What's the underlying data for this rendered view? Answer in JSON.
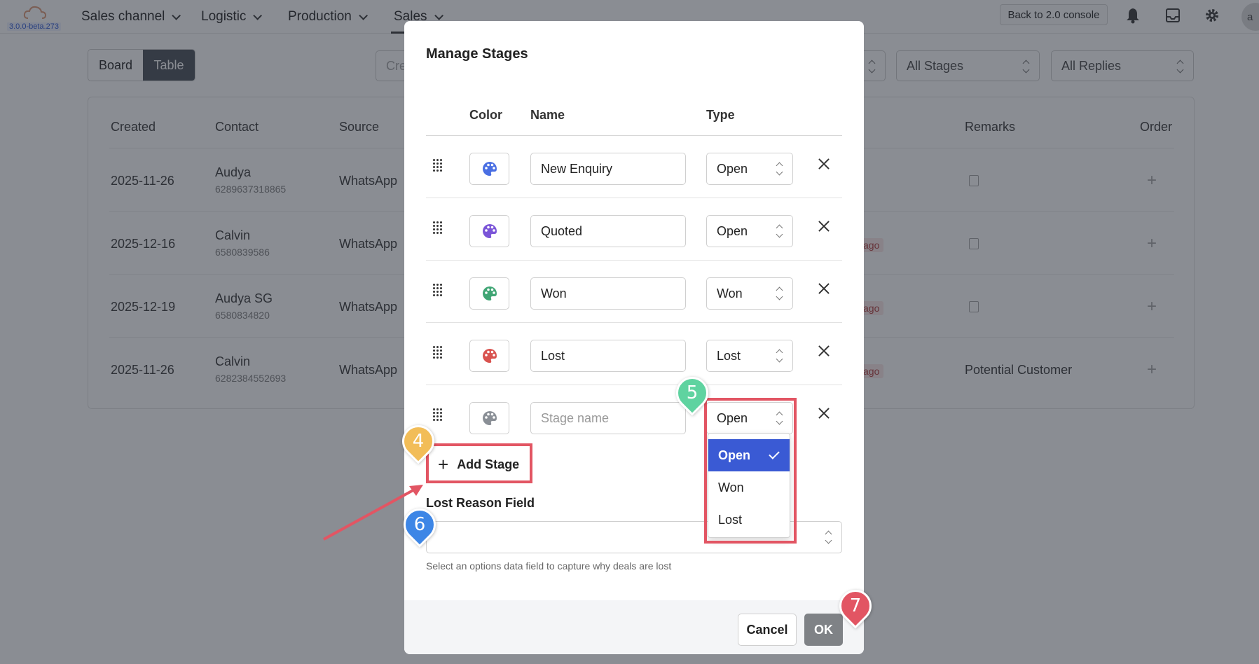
{
  "app": {
    "version": "3.0.0-beta.273",
    "nav": [
      {
        "label": "Sales channel"
      },
      {
        "label": "Logistic"
      },
      {
        "label": "Production"
      },
      {
        "label": "Sales"
      }
    ],
    "back_button": "Back to 2.0 console",
    "avatar_initials": "a"
  },
  "toolbar": {
    "view_board": "Board",
    "view_table": "Table",
    "search_placeholder": "Cre",
    "stages_filter": "All Stages",
    "replies_filter": "All Replies"
  },
  "table": {
    "headers": {
      "created": "Created",
      "contact": "Contact",
      "source": "Source",
      "remarks": "Remarks",
      "order": "Order"
    },
    "rows": [
      {
        "created": "2025-11-26",
        "name": "Audya",
        "phone": "6289637318865",
        "source": "WhatsApp",
        "badge": "",
        "remarks": ""
      },
      {
        "created": "2025-12-16",
        "name": "Calvin",
        "phone": "6580839586",
        "source": "WhatsApp",
        "badge": "ago",
        "remarks": ""
      },
      {
        "created": "2025-12-19",
        "name": "Audya SG",
        "phone": "6580834820",
        "source": "WhatsApp",
        "badge": "ago",
        "remarks": ""
      },
      {
        "created": "2025-11-26",
        "name": "Calvin",
        "phone": "6282384552693",
        "source": "WhatsApp",
        "badge": "ago",
        "remarks": "Potential Customer"
      }
    ]
  },
  "modal": {
    "title": "Manage Stages",
    "columns": {
      "color": "Color",
      "name": "Name",
      "type": "Type"
    },
    "stages": [
      {
        "name": "New Enquiry",
        "type": "Open",
        "color": "#4a6fe3"
      },
      {
        "name": "Quoted",
        "type": "Open",
        "color": "#7b55d8"
      },
      {
        "name": "Won",
        "type": "Won",
        "color": "#3fa574"
      },
      {
        "name": "Lost",
        "type": "Lost",
        "color": "#d9534f"
      },
      {
        "name": "",
        "placeholder": "Stage name",
        "type": "Open",
        "color": "#8a8f96"
      }
    ],
    "add_stage": "Add Stage",
    "lost_reason_label": "Lost Reason Field",
    "lost_reason_value": "",
    "lost_reason_helper": "Select an options data field to capture why deals are lost",
    "cancel": "Cancel",
    "ok": "OK"
  },
  "type_dropdown": {
    "options": [
      "Open",
      "Won",
      "Lost"
    ],
    "selected": "Open"
  },
  "annotations": [
    {
      "number": "4",
      "color": "#f2bd58"
    },
    {
      "number": "5",
      "color": "#5fd3a0"
    },
    {
      "number": "6",
      "color": "#3d86e6"
    },
    {
      "number": "7",
      "color": "#e25563"
    }
  ],
  "colors": {
    "highlight": "#e25563",
    "selected": "#3a5ad4"
  }
}
